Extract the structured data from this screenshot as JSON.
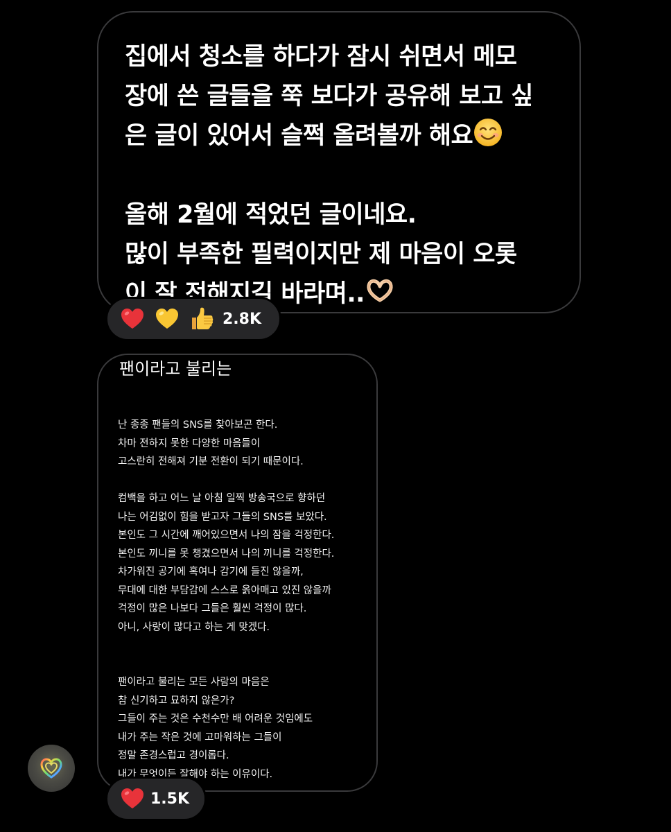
{
  "message": {
    "lines": [
      "집에서 청소를 하다가 잠시 쉬면서 메모",
      "장에 쓴 글들을 쭉 보다가 공유해 보고 싶",
      "은 글이 있어서 슬쩍 올려볼까 해요",
      "",
      "올해 2월에 적었던 글이네요.",
      "많이 부족한 필력이지만 제 마음이 오롯",
      "이 잘 전해지길 바라며.."
    ],
    "reactions": {
      "emojis": [
        "red-heart",
        "yellow-heart",
        "thumbs-up"
      ],
      "count": "2.8K"
    }
  },
  "memo": {
    "title": "팬이라고 불리는",
    "paragraph1": [
      "난 종종 팬들의 SNS를 찾아보곤 한다.",
      "차마 전하지 못한 다양한 마음들이",
      "고스란히 전해져 기분 전환이 되기 때문이다."
    ],
    "paragraph2": [
      "컴백을 하고 어느 날 아침 일찍 방송국으로 향하던",
      "나는 어김없이 힘을 받고자 그들의 SNS를 보았다.",
      "본인도 그 시간에 깨어있으면서 나의 잠을 걱정한다.",
      "본인도 끼니를 못 챙겼으면서 나의 끼니를 걱정한다.",
      "차가워진 공기에 혹여나 감기에 들진 않을까,",
      "무대에 대한 부담감에 스스로 옭아매고 있진 않을까",
      "걱정이 많은 나보다 그들은 훨씬 걱정이 많다.",
      "아니, 사랑이 많다고 하는 게 맞겠다."
    ],
    "paragraph3": [
      "팬이라고 불리는 모든 사람의 마음은",
      "참 신기하고 묘하지 않은가?",
      "그들이 주는 것은 수천수만 배 어려운 것임에도",
      "내가 주는 작은 것에 고마워하는 그들이",
      "정말 존경스럽고 경이롭다.",
      "내가 무엇이든 잘해야 하는 이유이다."
    ],
    "reactions": {
      "emojis": [
        "red-heart"
      ],
      "count": "1.5K"
    }
  },
  "colors": {
    "background": "#000000",
    "bubble_border": "#3a3a3c",
    "reaction_pill": "#262628",
    "text": "#ffffff"
  }
}
